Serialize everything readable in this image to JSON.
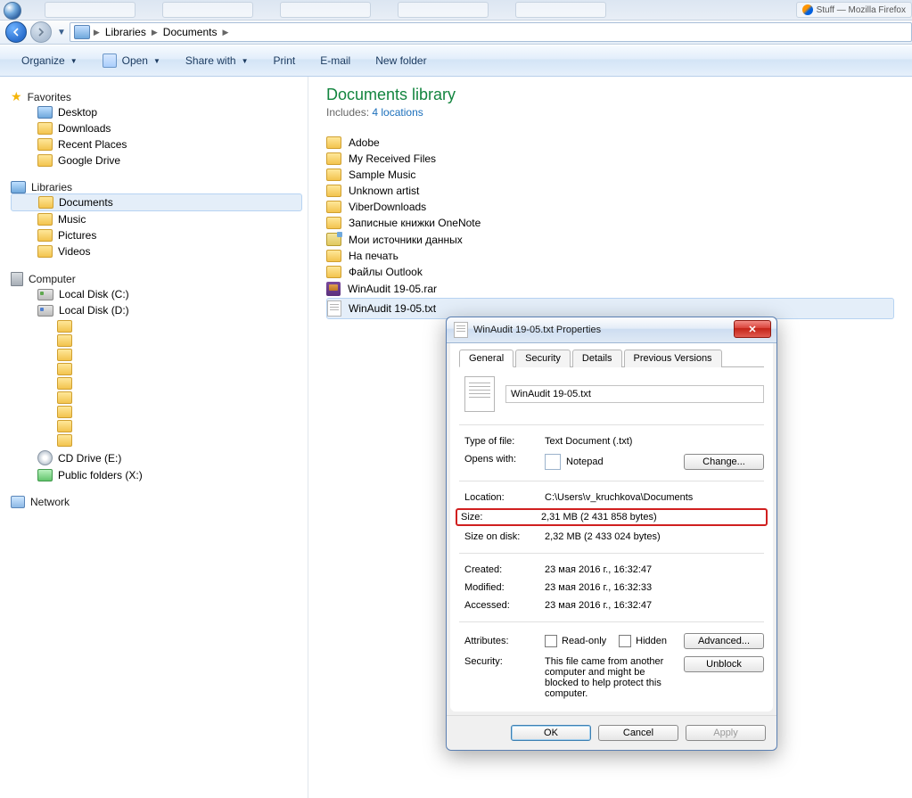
{
  "taskbar": {
    "ff_hint": "Stuff — Mozilla Firefox"
  },
  "breadcrumb": {
    "part1": "Libraries",
    "part2": "Documents"
  },
  "toolbar": {
    "organize": "Organize",
    "open": "Open",
    "share": "Share with",
    "print": "Print",
    "email": "E-mail",
    "newfolder": "New folder"
  },
  "nav": {
    "favorites": "Favorites",
    "desktop": "Desktop",
    "downloads": "Downloads",
    "recent": "Recent Places",
    "gdrive": "Google Drive",
    "libraries": "Libraries",
    "documents": "Documents",
    "music": "Music",
    "pictures": "Pictures",
    "videos": "Videos",
    "computer": "Computer",
    "localC": "Local Disk (C:)",
    "localD": "Local Disk (D:)",
    "cd": "CD Drive (E:)",
    "public": "Public folders (X:)",
    "network": "Network"
  },
  "library": {
    "title": "Documents library",
    "includes": "Includes:",
    "locations": "4 locations"
  },
  "files": [
    "Adobe",
    "My Received Files",
    "Sample Music",
    "Unknown artist",
    "ViberDownloads",
    "Записные книжки OneNote",
    "Мои источники данных",
    "На печать",
    "Файлы Outlook",
    "WinAudit 19-05.rar",
    "WinAudit 19-05.txt"
  ],
  "dialog": {
    "title": "WinAudit 19-05.txt Properties",
    "tabs": {
      "general": "General",
      "security": "Security",
      "details": "Details",
      "prev": "Previous Versions"
    },
    "filename": "WinAudit 19-05.txt",
    "type_k": "Type of file:",
    "type_v": "Text Document (.txt)",
    "open_k": "Opens with:",
    "open_v": "Notepad",
    "change": "Change...",
    "loc_k": "Location:",
    "loc_v": "C:\\Users\\v_kruchkova\\Documents",
    "size_k": "Size:",
    "size_v": "2,31 MB (2 431 858 bytes)",
    "sod_k": "Size on disk:",
    "sod_v": "2,32 MB (2 433 024 bytes)",
    "created_k": "Created:",
    "created_v": "23 мая 2016 г., 16:32:47",
    "mod_k": "Modified:",
    "mod_v": "23 мая 2016 г., 16:32:33",
    "acc_k": "Accessed:",
    "acc_v": "23 мая 2016 г., 16:32:47",
    "attr_k": "Attributes:",
    "ro": "Read-only",
    "hidden": "Hidden",
    "adv": "Advanced...",
    "sec_k": "Security:",
    "sec_v": "This file came from another computer and might be blocked to help protect this computer.",
    "unblock": "Unblock",
    "ok": "OK",
    "cancel": "Cancel",
    "apply": "Apply"
  }
}
